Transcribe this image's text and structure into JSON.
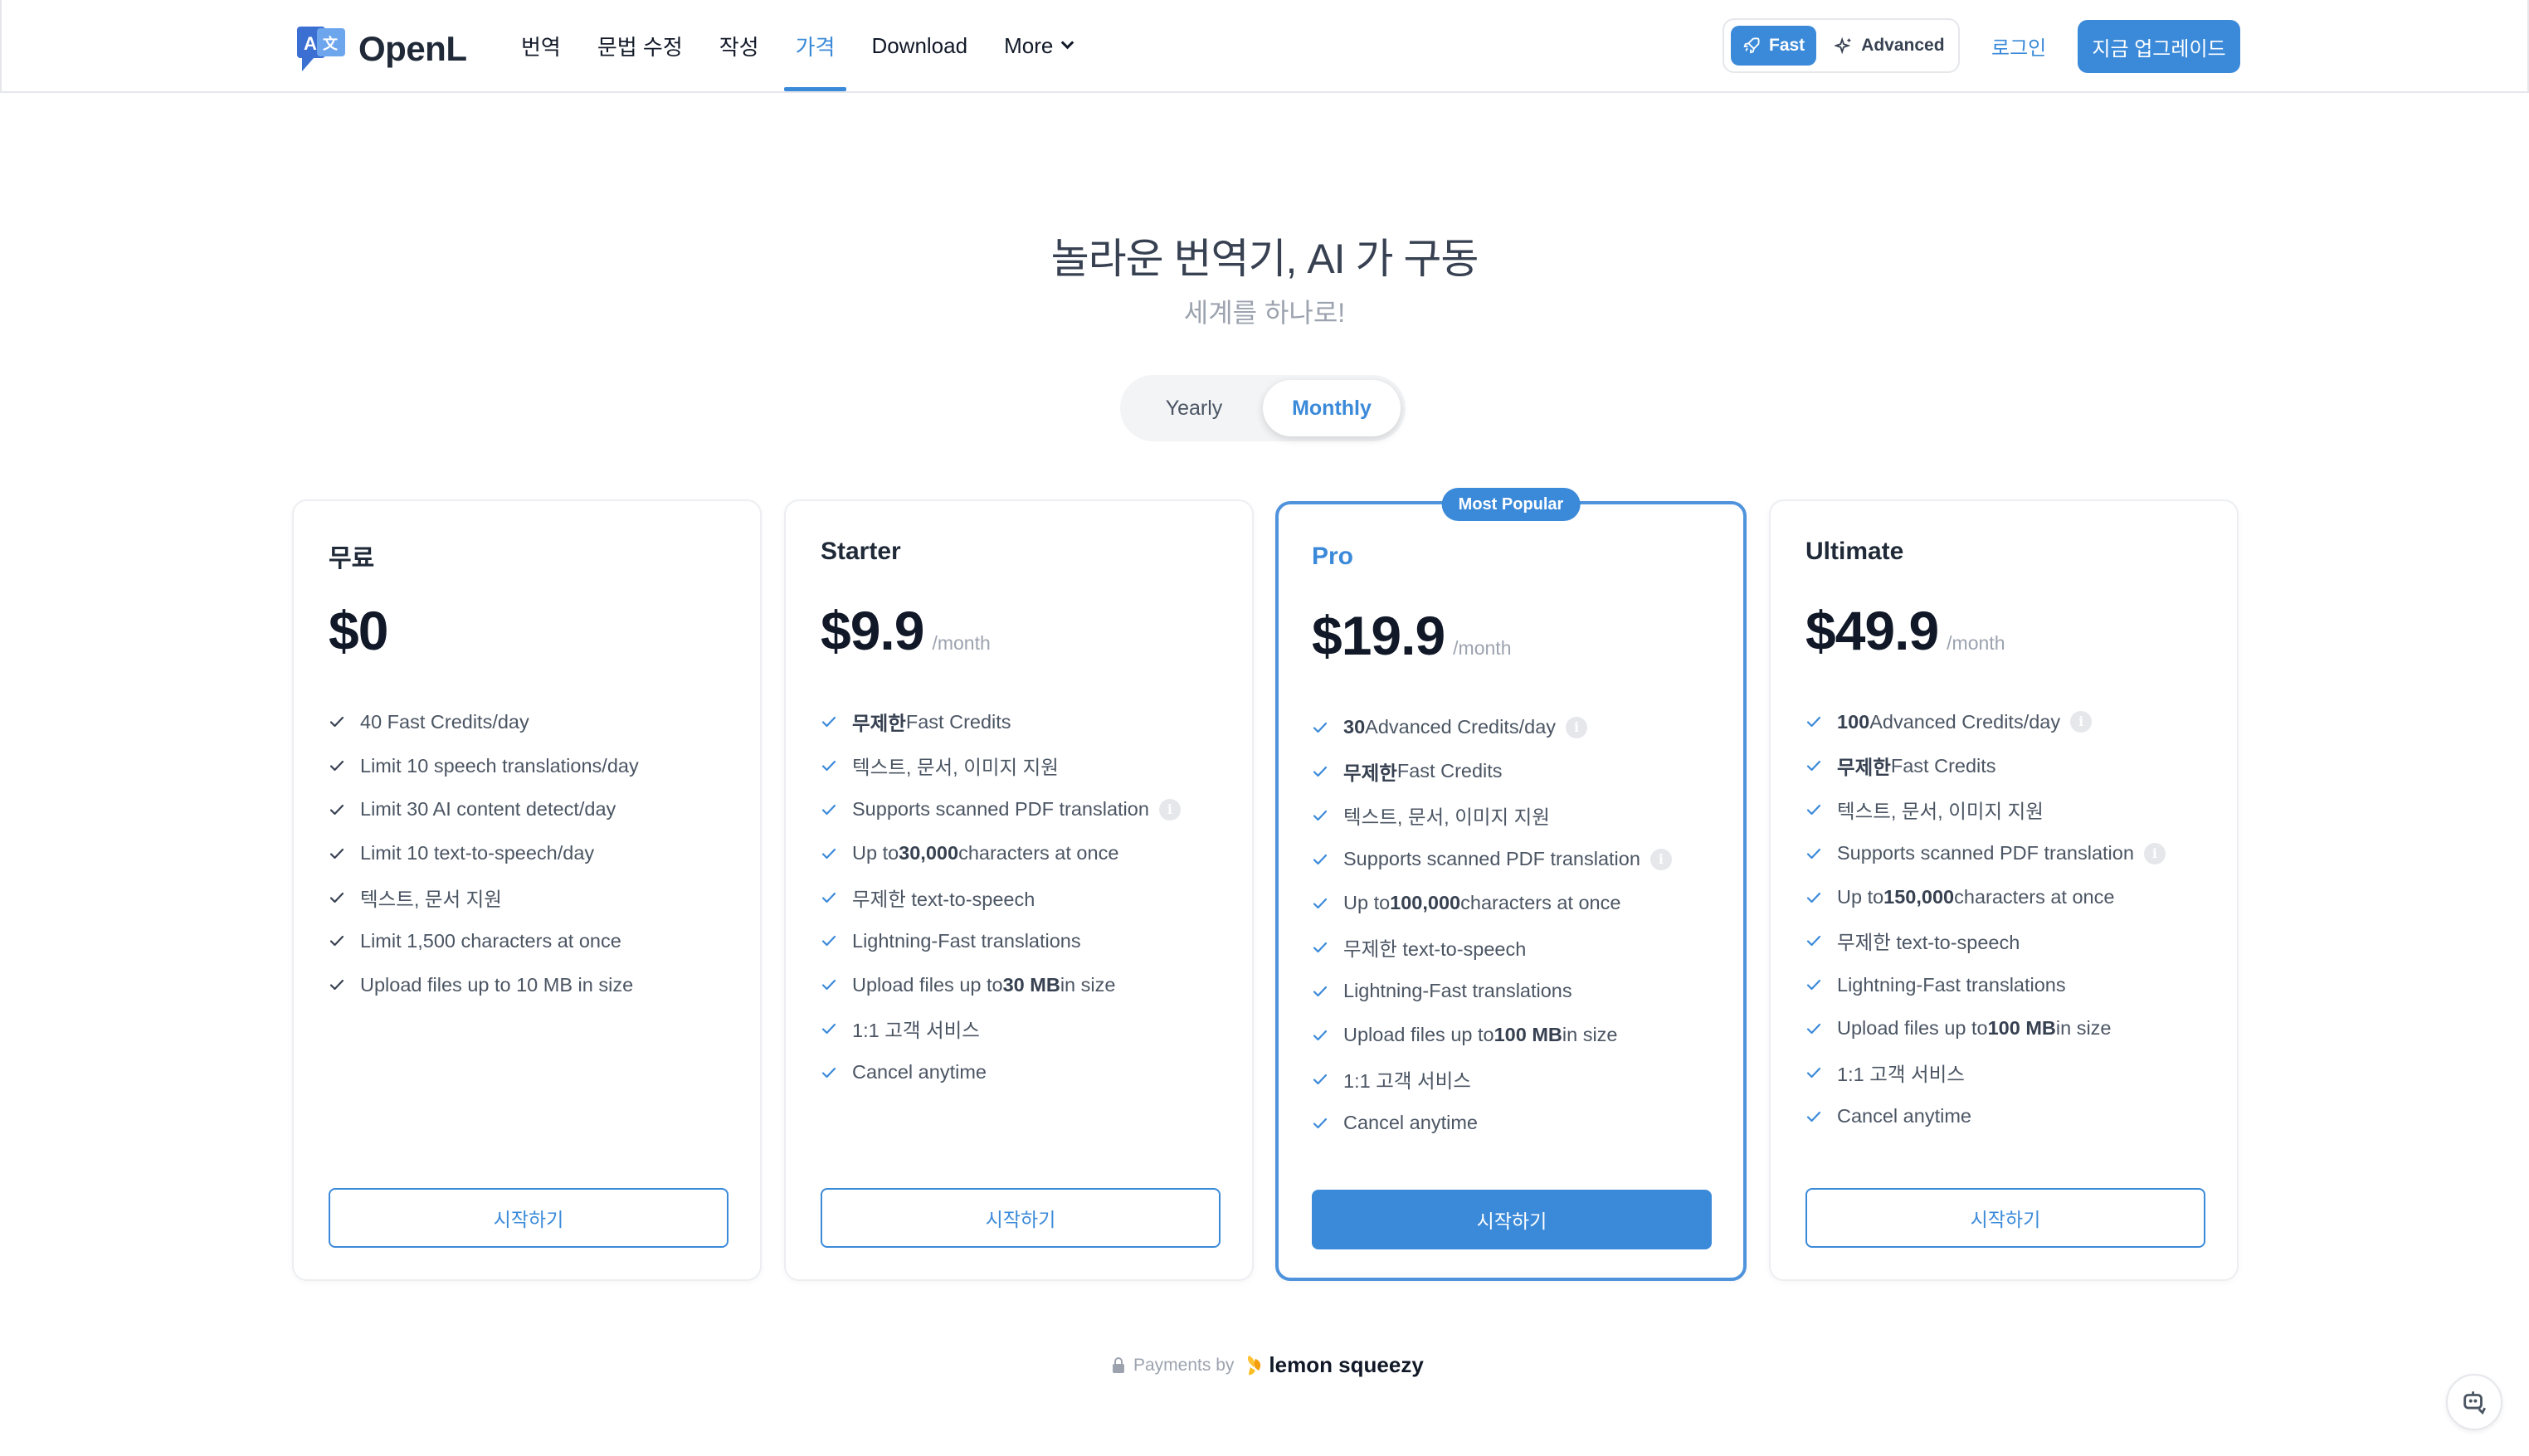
{
  "app": {
    "logo_text": "OpenL"
  },
  "nav": {
    "items": [
      {
        "label": "번역",
        "active": false
      },
      {
        "label": "문법 수정",
        "active": false
      },
      {
        "label": "작성",
        "active": false
      },
      {
        "label": "가격",
        "active": true
      },
      {
        "label": "Download",
        "active": false
      },
      {
        "label": "More",
        "active": false
      }
    ]
  },
  "mode": {
    "fast_label": "Fast",
    "advanced_label": "Advanced",
    "selected": "Fast"
  },
  "header": {
    "login_label": "로그인",
    "upgrade_label": "지금 업그레이드"
  },
  "hero": {
    "title": "놀라운 번역기, AI 가 구동",
    "subtitle": "세계를 하나로!"
  },
  "billing": {
    "yearly_label": "Yearly",
    "monthly_label": "Monthly",
    "selected": "Monthly"
  },
  "plans": [
    {
      "name": "무료",
      "price": "$0",
      "period": "",
      "features": [
        {
          "pre": "40 Fast Credits/day",
          "bold": "",
          "post": "",
          "info": false
        },
        {
          "pre": "Limit 10 speech translations/day",
          "bold": "",
          "post": "",
          "info": false
        },
        {
          "pre": "Limit 30 AI content detect/day",
          "bold": "",
          "post": "",
          "info": false
        },
        {
          "pre": "Limit 10 text-to-speech/day",
          "bold": "",
          "post": "",
          "info": false
        },
        {
          "pre": "텍스트, 문서 지원",
          "bold": "",
          "post": "",
          "info": false
        },
        {
          "pre": "Limit 1,500 characters at once",
          "bold": "",
          "post": "",
          "info": false
        },
        {
          "pre": "Upload files up to 10 MB in size",
          "bold": "",
          "post": "",
          "info": false
        }
      ],
      "cta": "시작하기"
    },
    {
      "name": "Starter",
      "price": "$9.9",
      "period": "/month",
      "features": [
        {
          "pre": "",
          "bold": "무제한",
          "post": " Fast Credits",
          "info": false
        },
        {
          "pre": "텍스트, 문서, 이미지 지원",
          "bold": "",
          "post": "",
          "info": false
        },
        {
          "pre": "Supports scanned PDF translation",
          "bold": "",
          "post": "",
          "info": true
        },
        {
          "pre": "Up to ",
          "bold": "30,000",
          "post": " characters at once",
          "info": false
        },
        {
          "pre": "무제한 text-to-speech",
          "bold": "",
          "post": "",
          "info": false
        },
        {
          "pre": "Lightning-Fast translations",
          "bold": "",
          "post": "",
          "info": false
        },
        {
          "pre": "Upload files up to ",
          "bold": "30 MB",
          "post": " in size",
          "info": false
        },
        {
          "pre": "1:1 고객 서비스",
          "bold": "",
          "post": "",
          "info": false
        },
        {
          "pre": "Cancel anytime",
          "bold": "",
          "post": "",
          "info": false
        }
      ],
      "cta": "시작하기"
    },
    {
      "name": "Pro",
      "price": "$19.9",
      "period": "/month",
      "badge": "Most Popular",
      "features": [
        {
          "pre": "",
          "bold": "30",
          "post": " Advanced Credits/day",
          "info": true
        },
        {
          "pre": "",
          "bold": "무제한",
          "post": " Fast Credits",
          "info": false
        },
        {
          "pre": "텍스트, 문서, 이미지 지원",
          "bold": "",
          "post": "",
          "info": false
        },
        {
          "pre": "Supports scanned PDF translation",
          "bold": "",
          "post": "",
          "info": true
        },
        {
          "pre": "Up to ",
          "bold": "100,000",
          "post": " characters at once",
          "info": false
        },
        {
          "pre": "무제한 text-to-speech",
          "bold": "",
          "post": "",
          "info": false
        },
        {
          "pre": "Lightning-Fast translations",
          "bold": "",
          "post": "",
          "info": false
        },
        {
          "pre": "Upload files up to ",
          "bold": "100 MB",
          "post": " in size",
          "info": false
        },
        {
          "pre": "1:1 고객 서비스",
          "bold": "",
          "post": "",
          "info": false
        },
        {
          "pre": "Cancel anytime",
          "bold": "",
          "post": "",
          "info": false
        }
      ],
      "cta": "시작하기"
    },
    {
      "name": "Ultimate",
      "price": "$49.9",
      "period": "/month",
      "features": [
        {
          "pre": "",
          "bold": "100",
          "post": " Advanced Credits/day",
          "info": true
        },
        {
          "pre": "",
          "bold": "무제한",
          "post": " Fast Credits",
          "info": false
        },
        {
          "pre": "텍스트, 문서, 이미지 지원",
          "bold": "",
          "post": "",
          "info": false
        },
        {
          "pre": "Supports scanned PDF translation",
          "bold": "",
          "post": "",
          "info": true
        },
        {
          "pre": "Up to ",
          "bold": "150,000",
          "post": " characters at once",
          "info": false
        },
        {
          "pre": "무제한 text-to-speech",
          "bold": "",
          "post": "",
          "info": false
        },
        {
          "pre": "Lightning-Fast translations",
          "bold": "",
          "post": "",
          "info": false
        },
        {
          "pre": "Upload files up to ",
          "bold": "100 MB",
          "post": " in size",
          "info": false
        },
        {
          "pre": "1:1 고객 서비스",
          "bold": "",
          "post": "",
          "info": false
        },
        {
          "pre": "Cancel anytime",
          "bold": "",
          "post": "",
          "info": false
        }
      ],
      "cta": "시작하기"
    }
  ],
  "footer": {
    "payments_label": "Payments by",
    "provider": "lemon squeezy"
  },
  "colors": {
    "accent": "#3b8ad9",
    "text": "#1f2937",
    "muted": "#9ca3af",
    "border": "#e5e7eb"
  },
  "icons": {
    "logo": "translate-logo-icon",
    "fast": "rocket-icon",
    "advanced": "sparkles-icon",
    "check": "check-icon",
    "info": "info-icon",
    "lock": "lock-icon",
    "lemon": "lemon-squeezy-logo-icon",
    "float": "assistant-icon"
  }
}
